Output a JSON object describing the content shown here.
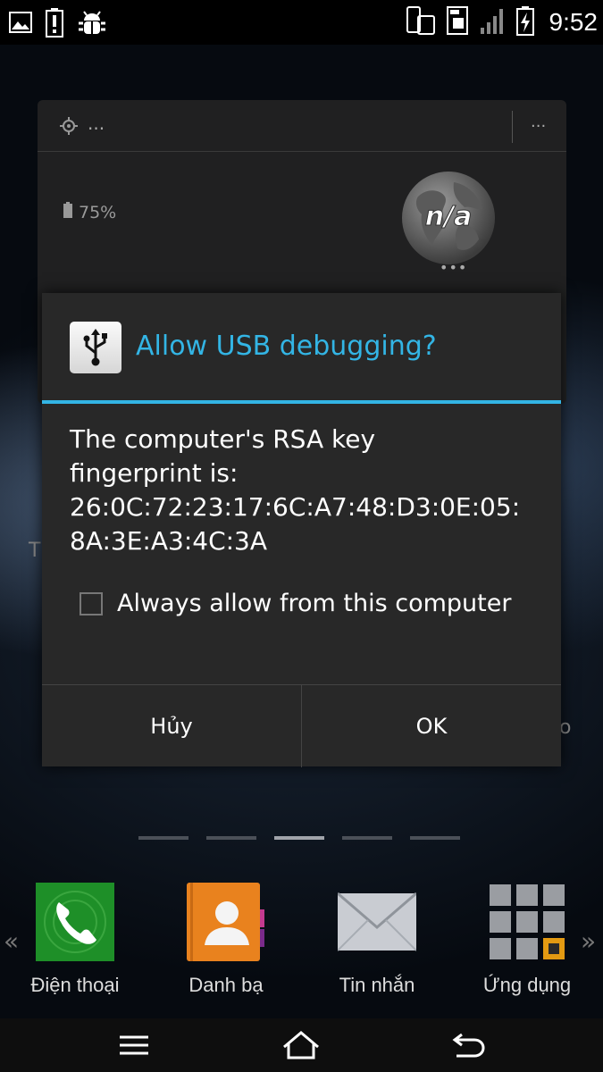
{
  "status_bar": {
    "time": "9:52",
    "left_icons": [
      "image-notification-icon",
      "battery-notification-icon",
      "android-debug-icon"
    ],
    "right_icons": [
      "screen-rotation-icon",
      "data-saver-icon",
      "signal-icon",
      "battery-charging-icon"
    ]
  },
  "widget": {
    "location_label": "...",
    "menu_label": "...",
    "battery_text": "75%",
    "globe_text": "n/a",
    "globe_dots": "•••"
  },
  "background_fragments": {
    "left": "T",
    "right": "o"
  },
  "dialog": {
    "title": "Allow USB debugging?",
    "message_lines": [
      "The computer's RSA key",
      "fingerprint is:",
      "26:0C:72:23:17:6C:A7:48:D3:0E:05:",
      "8A:3E:A3:4C:3A"
    ],
    "checkbox_label": "Always allow from this computer",
    "checkbox_checked": false,
    "cancel_label": "Hủy",
    "ok_label": "OK",
    "accent_color": "#33b5e5"
  },
  "pager": {
    "pages": 5,
    "active_index": 2
  },
  "dock": {
    "left_arrow": "«",
    "right_arrow": "»",
    "apps": [
      {
        "label": "Điện thoại",
        "icon": "phone-icon"
      },
      {
        "label": "Danh bạ",
        "icon": "contacts-icon"
      },
      {
        "label": "Tin nhắn",
        "icon": "messages-icon"
      },
      {
        "label": "Ứng dụng",
        "icon": "app-drawer-icon"
      }
    ]
  },
  "nav_bar": {
    "buttons": [
      "menu-icon",
      "home-icon",
      "back-icon"
    ]
  }
}
